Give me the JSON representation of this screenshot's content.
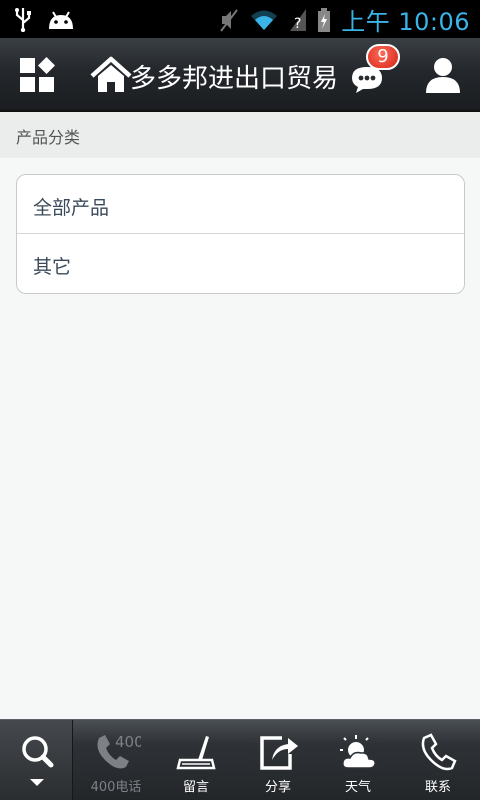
{
  "status_bar": {
    "time": "上午 10:06",
    "time_color": "#3ab4e8"
  },
  "title_bar": {
    "title": "多多邦进出口贸易",
    "message_badge_count": "9",
    "badge_color": "#d42414"
  },
  "section": {
    "title": "产品分类"
  },
  "categories": [
    {
      "label": "全部产品"
    },
    {
      "label": "其它"
    }
  ],
  "bottom_bar": {
    "items": [
      {
        "label": "400电话",
        "icon": "phone-400-icon",
        "enabled": false,
        "badge_text": "400"
      },
      {
        "label": "留言",
        "icon": "pen-icon",
        "enabled": true
      },
      {
        "label": "分享",
        "icon": "share-icon",
        "enabled": true
      },
      {
        "label": "天气",
        "icon": "weather-icon",
        "enabled": true
      },
      {
        "label": "联系",
        "icon": "phone-icon",
        "enabled": true
      }
    ]
  }
}
